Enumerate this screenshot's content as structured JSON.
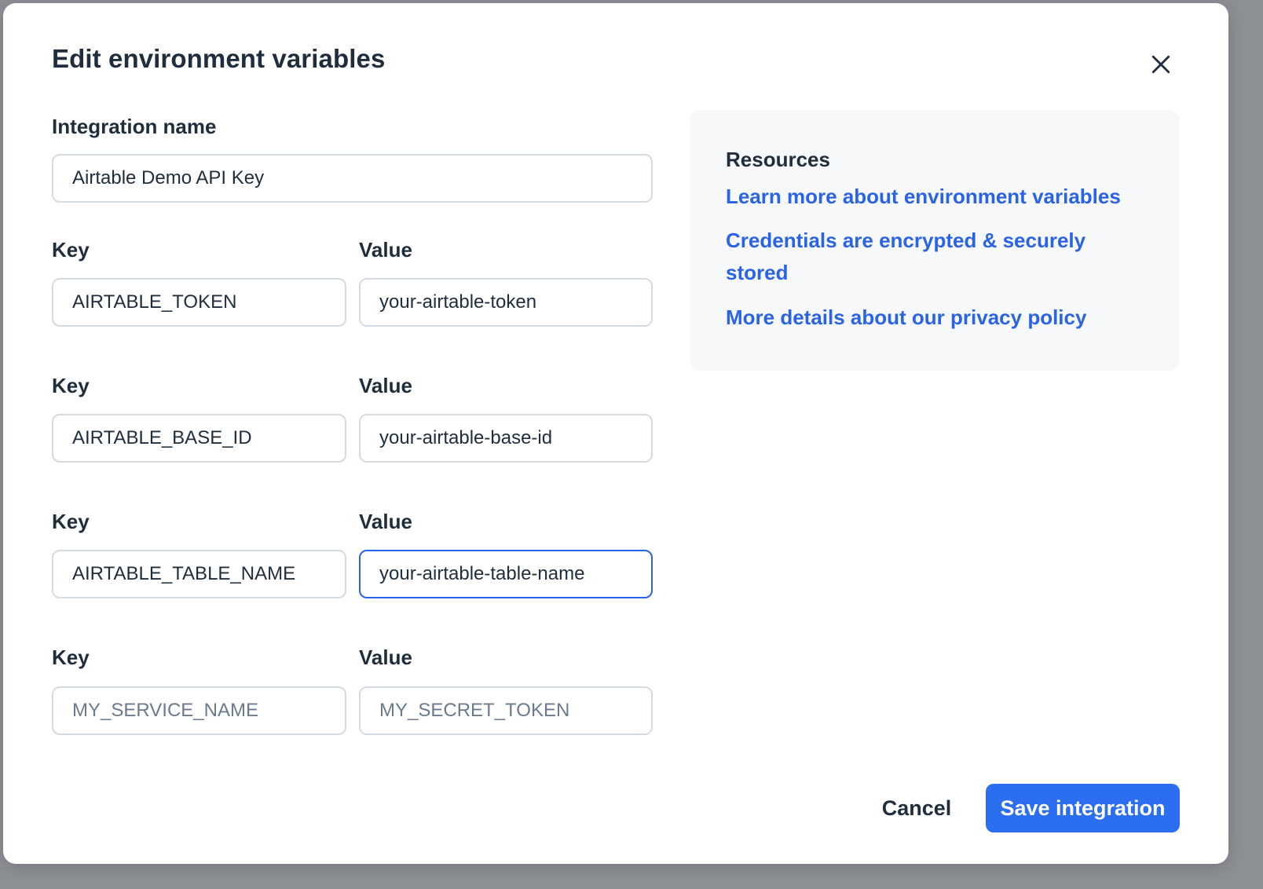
{
  "modal": {
    "title": "Edit environment variables",
    "close_icon": "close-icon"
  },
  "integration": {
    "label": "Integration name",
    "value": "Airtable Demo API Key"
  },
  "variables": [
    {
      "key_label": "Key",
      "value_label": "Value",
      "key": "AIRTABLE_TOKEN",
      "value": "your-airtable-token"
    },
    {
      "key_label": "Key",
      "value_label": "Value",
      "key": "AIRTABLE_BASE_ID",
      "value": "your-airtable-base-id"
    },
    {
      "key_label": "Key",
      "value_label": "Value",
      "key": "AIRTABLE_TABLE_NAME",
      "value": "your-airtable-table-name"
    },
    {
      "key_label": "Key",
      "value_label": "Value",
      "key_placeholder": "MY_SERVICE_NAME",
      "value_placeholder": "MY_SECRET_TOKEN"
    }
  ],
  "resources": {
    "title": "Resources",
    "links": [
      "Learn more about environment variables",
      "Credentials are encrypted & securely stored",
      "More details about our privacy policy"
    ]
  },
  "footer": {
    "cancel_label": "Cancel",
    "save_label": "Save integration"
  },
  "colors": {
    "accent": "#2b6ef0",
    "link": "#2b63e6",
    "text": "#1f2d3d",
    "panel": "#f6f8fa"
  }
}
